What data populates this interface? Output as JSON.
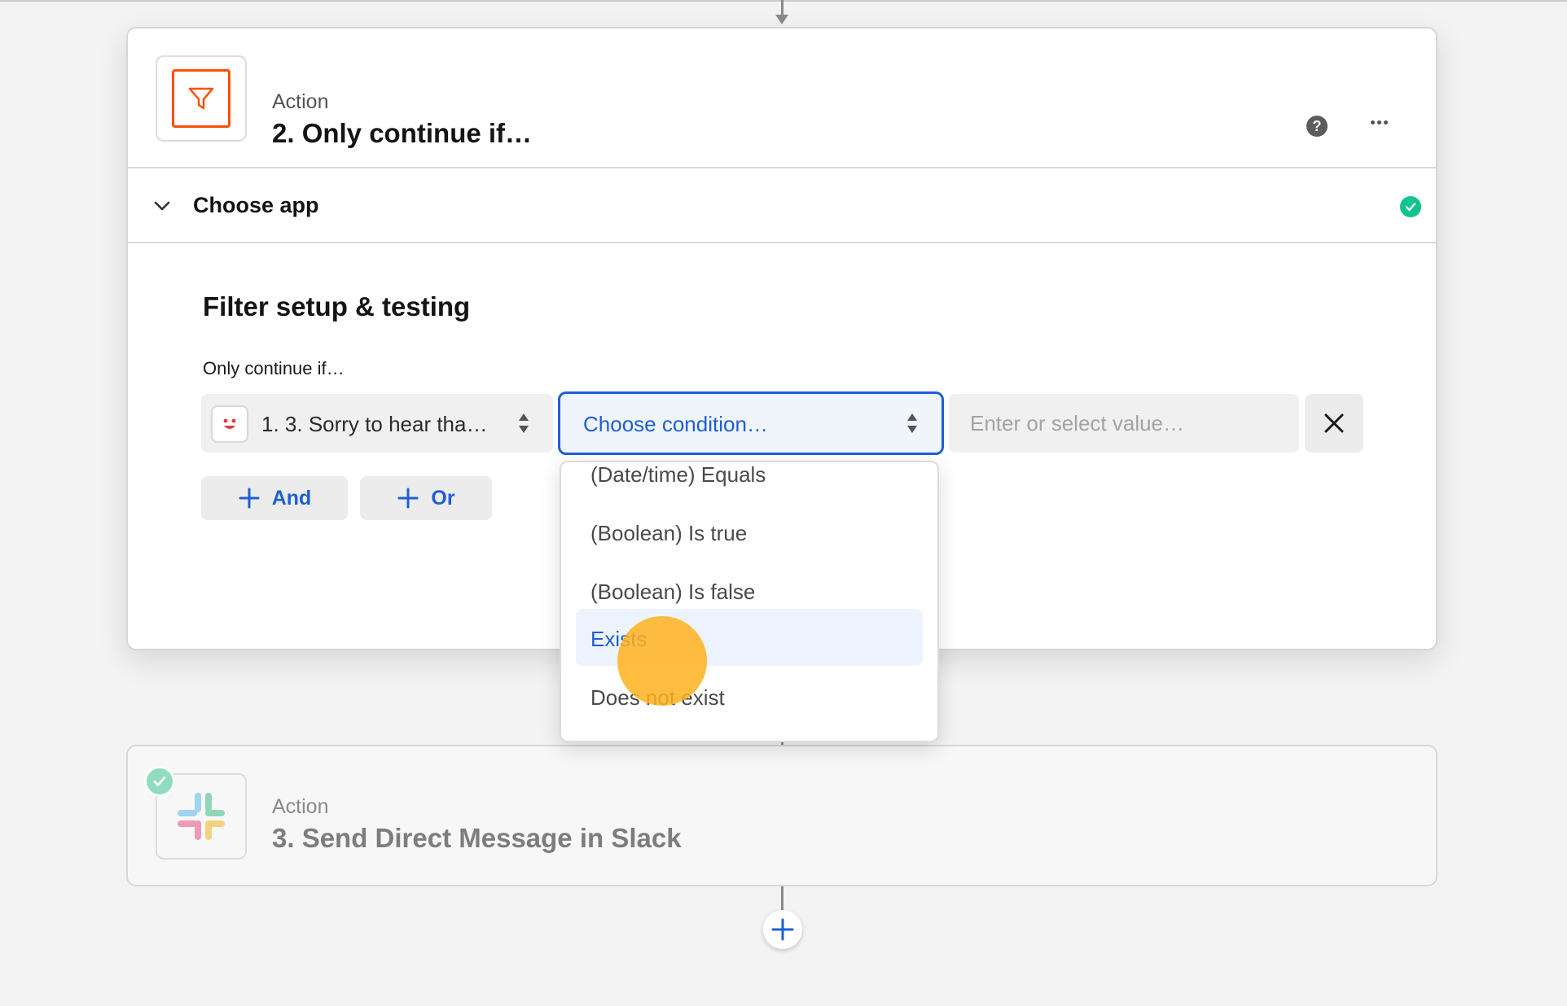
{
  "step_filter": {
    "kind": "Action",
    "title": "2. Only continue if…",
    "help_glyph": "?",
    "choose_app_label": "Choose app",
    "section_title": "Filter setup & testing",
    "continue_label": "Only continue if…",
    "field_value": "1. 3. Sorry to hear tha…",
    "condition_value": "Choose condition…",
    "value_placeholder": "Enter or select value…",
    "and_label": "And",
    "or_label": "Or"
  },
  "dropdown": {
    "items": [
      {
        "label": "(Date/time) Equals"
      },
      {
        "label": "(Boolean) Is true"
      },
      {
        "label": "(Boolean) Is false"
      },
      {
        "label": "Exists",
        "selected": true
      },
      {
        "label": "Does not exist"
      }
    ]
  },
  "step_slack": {
    "kind": "Action",
    "title": "3. Send Direct Message in Slack"
  },
  "icons": {
    "filter": "filter-funnel-icon",
    "help": "question-circle-icon",
    "more": "more-horizontal-icon",
    "chevron": "chevron-down-icon",
    "check": "check-circle-icon",
    "updown": "sort-arrows-icon",
    "close": "close-x-icon",
    "plus": "plus-icon",
    "slack": "slack-logo-icon"
  },
  "colors": {
    "accent_blue": "#1f5ed6",
    "filter_orange": "#ff4f00",
    "success_green": "#13c490",
    "cursor_orange": "#ffb21e"
  }
}
